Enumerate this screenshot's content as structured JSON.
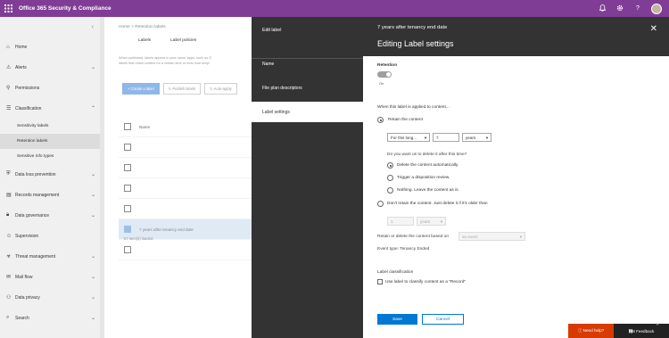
{
  "app": {
    "title": "Office 365 Security & Compliance"
  },
  "topbar": {
    "icons": [
      "bell-icon",
      "gear-icon",
      "help-icon"
    ],
    "help_glyph": "?"
  },
  "nav": {
    "items": [
      {
        "label": "Home",
        "icon": "home-icon"
      },
      {
        "label": "Alerts",
        "icon": "alert-icon"
      },
      {
        "label": "Permissions",
        "icon": "permissions-icon"
      },
      {
        "label": "Classification",
        "icon": "classification-icon"
      },
      {
        "label": "Sensitivity labels"
      },
      {
        "label": "Retention labels"
      },
      {
        "label": "Sensitive info types"
      },
      {
        "label": "Data loss prevention",
        "icon": "dlp-icon"
      },
      {
        "label": "Records management",
        "icon": "records-icon"
      },
      {
        "label": "Data governance",
        "icon": "lock-icon"
      },
      {
        "label": "Supervision",
        "icon": "supervision-icon"
      },
      {
        "label": "Threat management",
        "icon": "threat-icon"
      },
      {
        "label": "Mail flow",
        "icon": "mail-icon"
      },
      {
        "label": "Data privacy",
        "icon": "privacy-icon"
      },
      {
        "label": "Search",
        "icon": "search-icon"
      }
    ]
  },
  "page": {
    "breadcrumb": "Home  >  Retention labels",
    "tabs": [
      "Labels",
      "Label policies"
    ],
    "description_1": "When published, labels appear in your users' apps, such as O",
    "description_2": "labels that retain content for a certain time or even that simpl",
    "commands": {
      "create": "+ Create a label",
      "refresh": "↻ Publish labels",
      "auto": "↻ Auto-apply"
    },
    "column_name": "Name",
    "rows": [
      "",
      "",
      "",
      "",
      "7 years after tenancy end date",
      ""
    ],
    "count": "57 item(s) loaded."
  },
  "flyout_nav": {
    "title": "Edit label",
    "items": [
      "Name",
      "File plan descriptors",
      "Label settings"
    ]
  },
  "panel": {
    "subtitle": "7 years after tenancy end date",
    "title": "Editing Label settings",
    "retention_heading": "Retention",
    "retention_state": "On",
    "applied_heading": "When this label is applied to content...",
    "retain_option": "Retain the content",
    "for_this_long": "For this long...",
    "retain_number": "7",
    "retain_unit": "years",
    "delete_question": "Do you want us to delete it after this time?",
    "opt_delete": "Delete the content automatically.",
    "opt_review": "Trigger a disposition review.",
    "opt_nothing": "Nothing. Leave the content as is.",
    "dont_retain": "Don't retain the content. Just delete it if it's older than",
    "older_number": "1",
    "older_unit": "years",
    "based_on": "Retain or delete the content based on",
    "based_on_value": "an event",
    "event_type": "Event type: Tenancy Ended",
    "classification_heading": "Label classification",
    "record_option": "Use label to classify content as a \"Record\"",
    "save": "Save",
    "cancel": "Cancel"
  },
  "footer": {
    "need_help": "ⓘ Need help?",
    "feedback": "὞8 Feedback"
  }
}
